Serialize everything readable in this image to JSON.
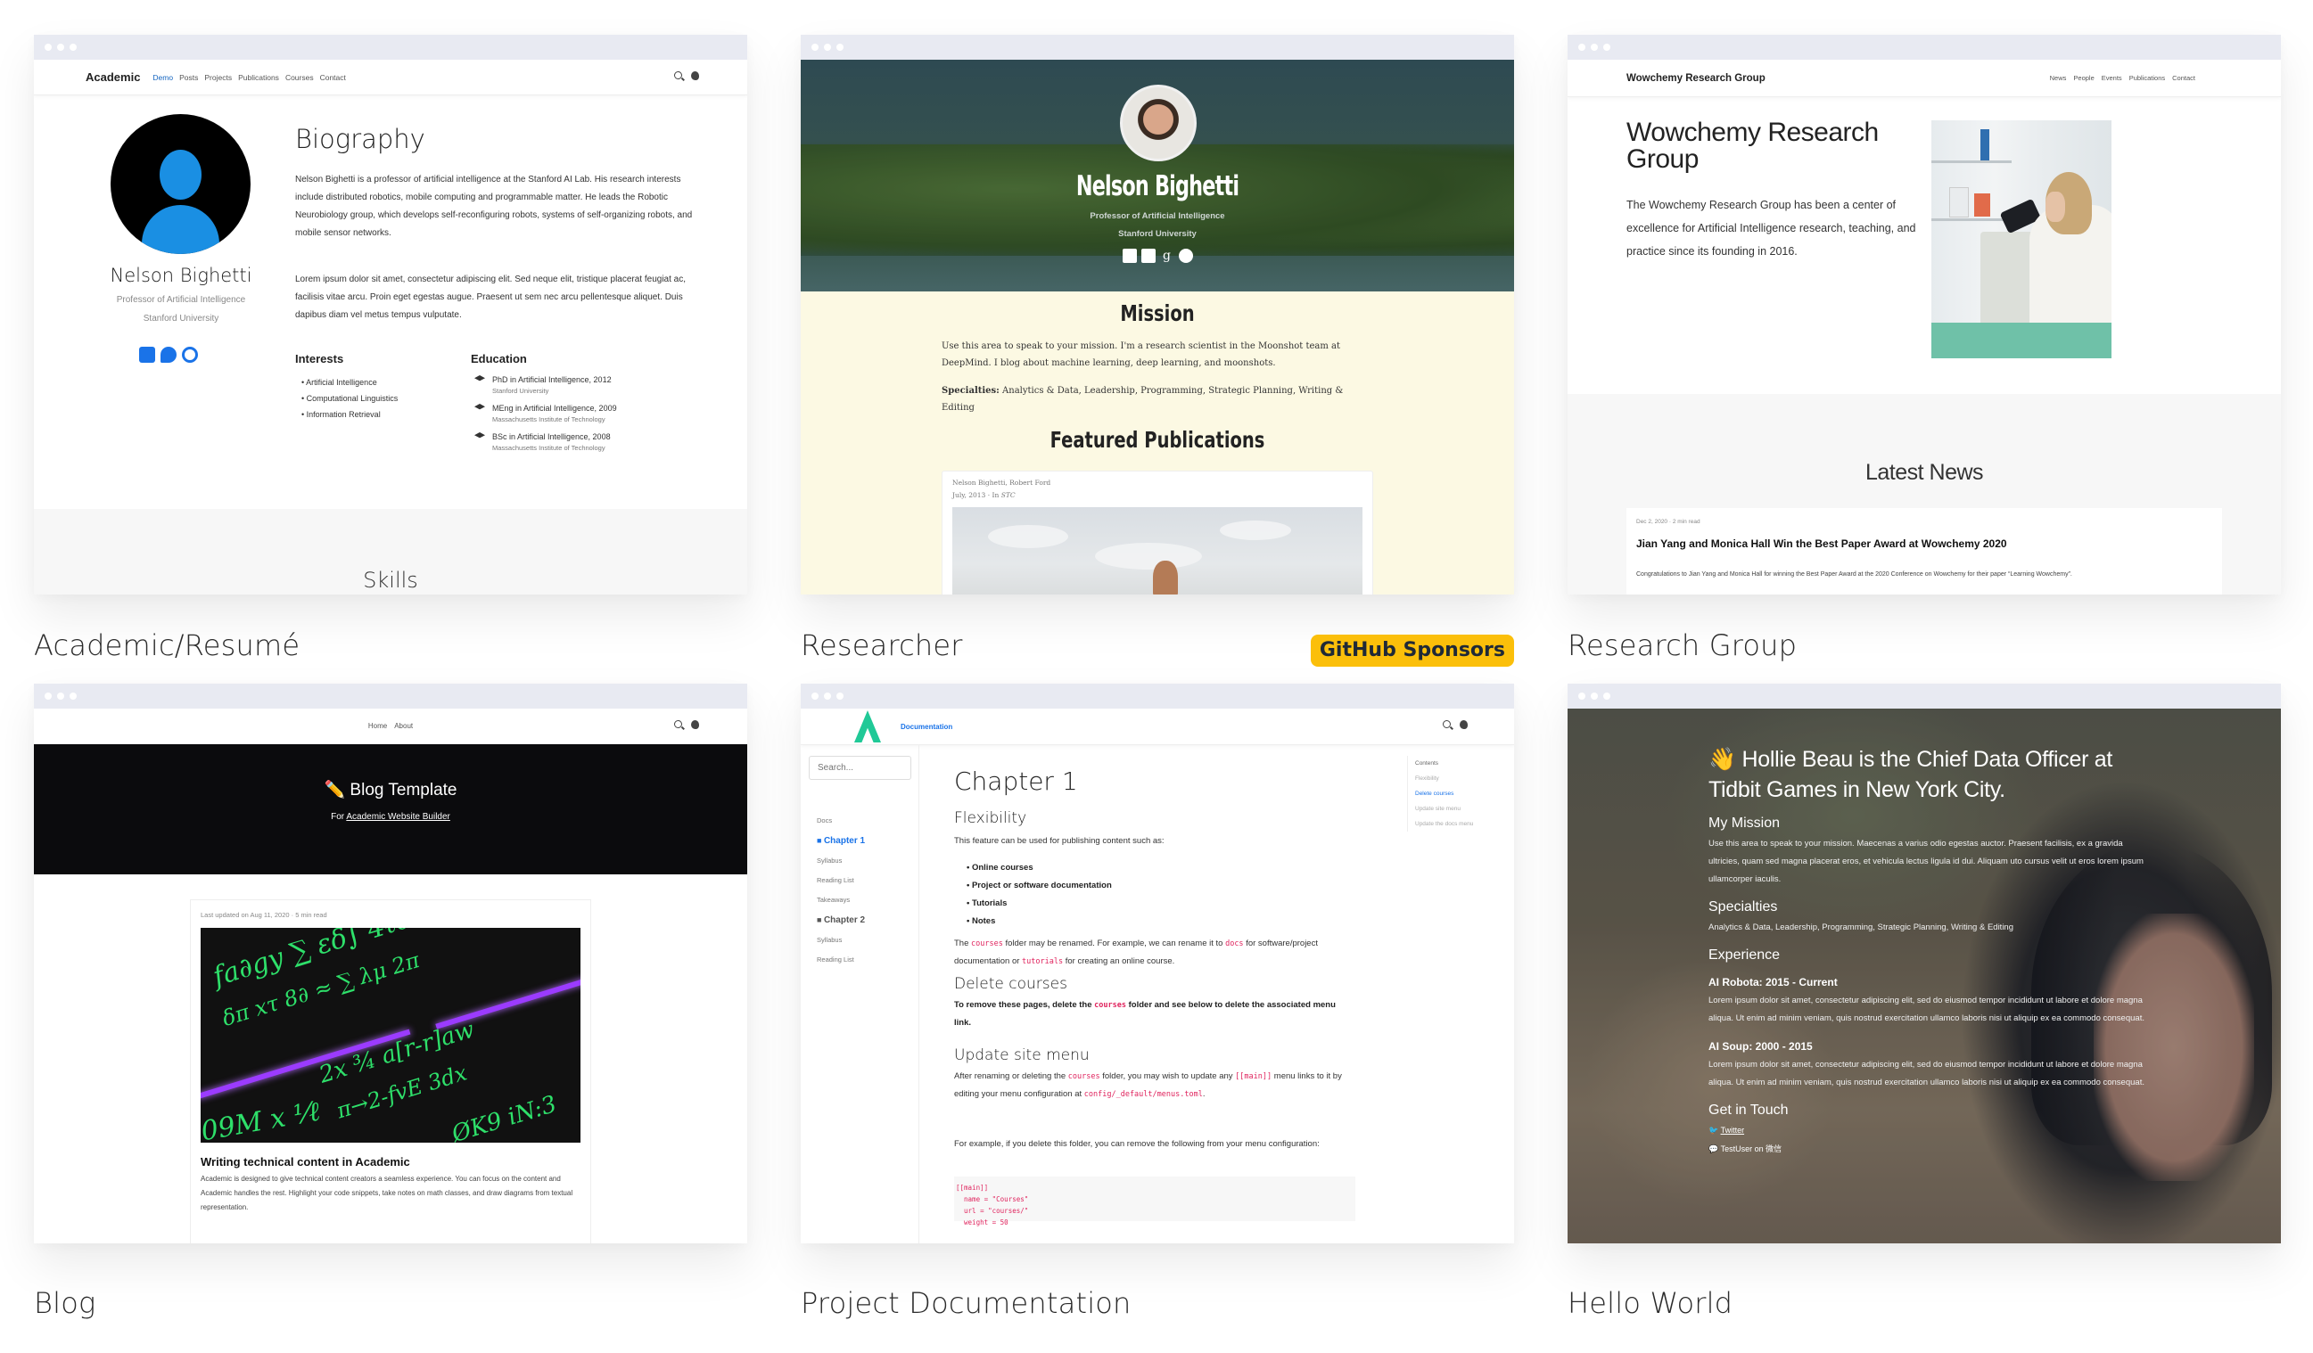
{
  "tiles": [
    {
      "title": "Academic/Resumé",
      "nav": {
        "brand": "Academic",
        "links": [
          "Demo",
          "Posts",
          "Projects",
          "Publications",
          "Courses",
          "Contact"
        ],
        "active": "Demo"
      },
      "profile": {
        "name": "Nelson Bighetti",
        "role": "Professor of Artificial Intelligence",
        "org": "Stanford University"
      },
      "biography_heading": "Biography",
      "biography": [
        "Nelson Bighetti is a professor of artificial intelligence at the Stanford AI Lab. His research interests include distributed robotics, mobile computing and programmable matter. He leads the Robotic Neurobiology group, which develops self-reconfiguring robots, systems of self-organizing robots, and mobile sensor networks.",
        "Lorem ipsum dolor sit amet, consectetur adipiscing elit. Sed neque elit, tristique placerat feugiat ac, facilisis vitae arcu. Proin eget egestas augue. Praesent ut sem nec arcu pellentesque aliquet. Duis dapibus diam vel metus tempus vulputate."
      ],
      "interests_heading": "Interests",
      "interests": [
        "Artificial Intelligence",
        "Computational Linguistics",
        "Information Retrieval"
      ],
      "education_heading": "Education",
      "education": [
        {
          "degree": "PhD in Artificial Intelligence, 2012",
          "institution": "Stanford University"
        },
        {
          "degree": "MEng in Artificial Intelligence, 2009",
          "institution": "Massachusetts Institute of Technology"
        },
        {
          "degree": "BSc in Artificial Intelligence, 2008",
          "institution": "Massachusetts Institute of Technology"
        }
      ],
      "skills_heading": "Skills"
    },
    {
      "title": "Researcher",
      "badge": "GitHub Sponsors",
      "profile": {
        "name": "Nelson Bighetti",
        "role": "Professor of Artificial Intelligence",
        "org": "Stanford University"
      },
      "mission_heading": "Mission",
      "mission": "Use this area to speak to your mission. I'm a research scientist in the Moonshot team at DeepMind. I blog about machine learning, deep learning, and moonshots.",
      "specialties_label": "Specialties:",
      "specialties": "Analytics & Data, Leadership, Programming, Strategic Planning, Writing & Editing",
      "publications_heading": "Featured Publications",
      "publication": {
        "authors": "Nelson Bighetti, Robert Ford",
        "date": "July, 2013",
        "venue_prefix": "In",
        "venue": "STC"
      }
    },
    {
      "title": "Research Group",
      "nav": {
        "brand": "Wowchemy Research Group",
        "links": [
          "News",
          "People",
          "Events",
          "Publications",
          "Contact"
        ]
      },
      "hero_title": "Wowchemy Research Group",
      "hero_text": "The Wowchemy Research Group has been a center of excellence for Artificial Intelligence research, teaching, and practice since its founding in 2016.",
      "news_heading": "Latest News",
      "news": {
        "date": "Dec 2, 2020",
        "read_time": "2 min read",
        "title": "Jian Yang and Monica Hall Win the Best Paper Award at Wowchemy 2020",
        "summary": "Congratulations to Jian Yang and Monica Hall for winning the Best Paper Award at the 2020 Conference on Wowchemy for their paper “Learning Wowchemy”."
      }
    },
    {
      "title": "Blog",
      "nav": {
        "links": [
          "Home",
          "About"
        ]
      },
      "hero_title": "✏️ Blog Template",
      "hero_sub_prefix": "For",
      "hero_sub_link": "Academic Website Builder",
      "post": {
        "meta": "Last updated on Aug 11, 2020 · 5 min read",
        "title": "Writing technical content in Academic",
        "summary": "Academic is designed to give technical content creators a seamless experience. You can focus on the content and Academic handles the rest. Highlight your code snippets, take notes on math classes, and draw diagrams from textual representation."
      }
    },
    {
      "title": "Project Documentation",
      "nav": {
        "links": [
          "Documentation"
        ]
      },
      "search_placeholder": "Search...",
      "sidebar": [
        {
          "label": "Docs",
          "type": "section"
        },
        {
          "label": "Chapter 1",
          "type": "chapter",
          "active": true
        },
        {
          "label": "Syllabus",
          "type": "page"
        },
        {
          "label": "Reading List",
          "type": "page"
        },
        {
          "label": "Takeaways",
          "type": "page"
        },
        {
          "label": "Chapter 2",
          "type": "chapter"
        },
        {
          "label": "Syllabus",
          "type": "page"
        },
        {
          "label": "Reading List",
          "type": "page"
        }
      ],
      "h1": "Chapter 1",
      "sections": {
        "flex_h": "Flexibility",
        "flex_p": "This feature can be used for publishing content such as:",
        "flex_list": [
          "Online courses",
          "Project or software documentation",
          "Tutorials",
          "Notes"
        ],
        "rename_p": [
          "The ",
          "courses",
          " folder may be renamed. For example, we can rename it to ",
          "docs",
          " for software/project documentation or ",
          "tutorials",
          " for creating an online course."
        ],
        "delete_h": "Delete courses",
        "delete_p": [
          "To remove these pages, delete the ",
          "courses",
          " folder and see below to delete the associated menu link."
        ],
        "update_h": "Update site menu",
        "update_p": [
          "After renaming or deleting the ",
          "courses",
          " folder, you may wish to update any ",
          "[[main]]",
          " menu links to it by editing your menu configuration at ",
          "config/_default/menus.toml",
          "."
        ],
        "example_p": "For example, if you delete this folder, you can remove the following from your menu configuration:",
        "code": [
          "[[main]]",
          "  name = \"Courses\"",
          "  url = \"courses/\"",
          "  weight = 50"
        ]
      },
      "toc": {
        "heading": "Contents",
        "items": [
          "Flexibility",
          "Delete courses",
          "Update site menu",
          "Update the docs menu"
        ],
        "active": "Delete courses"
      }
    },
    {
      "title": "Hello World",
      "hero_title": "👋 Hollie Beau is the Chief Data Officer at Tidbit Games in New York City.",
      "mission_h": "My Mission",
      "mission": "Use this area to speak to your mission. Maecenas a varius odio egestas auctor. Praesent facilisis, ex a gravida ultricies, quam sed magna placerat eros, et vehicula lectus ligula id dui. Aliquam uto cursus velit ut eros lorem ipsum ullamcorper iaculis.",
      "specialties_h": "Specialties",
      "specialties": "Analytics & Data, Leadership, Programming, Strategic Planning, Writing & Editing",
      "experience_h": "Experience",
      "experience": [
        {
          "role": "AI Robota: 2015 - Current",
          "text": "Lorem ipsum dolor sit amet, consectetur adipiscing elit, sed do eiusmod tempor incididunt ut labore et dolore magna aliqua. Ut enim ad minim veniam, quis nostrud exercitation ullamco laboris nisi ut aliquip ex ea commodo consequat."
        },
        {
          "role": "AI Soup: 2000 - 2015",
          "text": "Lorem ipsum dolor sit amet, consectetur adipiscing elit, sed do eiusmod tempor incididunt ut labore et dolore magna aliqua. Ut enim ad minim veniam, quis nostrud exercitation ullamco laboris nisi ut aliquip ex ea commodo consequat."
        }
      ],
      "contact_h": "Get in Touch",
      "twitter": "Twitter",
      "wechat": "TestUser on 微信"
    }
  ],
  "colors": {
    "browser_bar": "#e8eaf2",
    "accent_blue": "#1a73e8",
    "sponsor_badge": "#fbbf0a",
    "code_pink": "#e0245e",
    "docs_logo": "#20c997"
  }
}
